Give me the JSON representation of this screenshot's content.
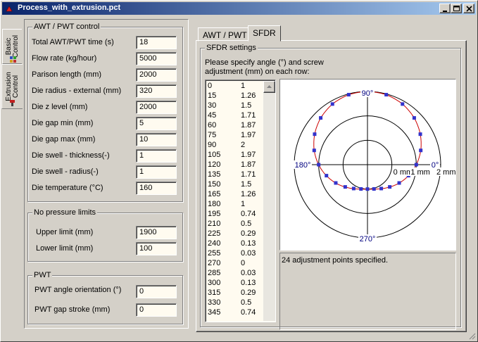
{
  "window": {
    "title": "Process_with_extrusion.pct"
  },
  "side_tabs": [
    {
      "label": "Basic Control",
      "line1": "Basic",
      "line2": "Control"
    },
    {
      "label": "Extrusion Control",
      "line1": "Extrusion",
      "line2": "Control"
    }
  ],
  "awt_pwt_control": {
    "title": "AWT / PWT control",
    "fields": [
      {
        "label": "Total AWT/PWT time (s)",
        "value": "18"
      },
      {
        "label": "Flow rate (kg/hour)",
        "value": "5000"
      },
      {
        "label": "Parison length (mm)",
        "value": "2000"
      },
      {
        "label": "Die radius - external (mm)",
        "value": "320"
      },
      {
        "label": "Die z level (mm)",
        "value": "2000"
      },
      {
        "label": "Die gap min (mm)",
        "value": "5"
      },
      {
        "label": "Die gap max (mm)",
        "value": "10"
      },
      {
        "label": "Die swell - thickness(-)",
        "value": "1"
      },
      {
        "label": "Die swell - radius(-)",
        "value": "1"
      },
      {
        "label": "Die temperature (°C)",
        "value": "160"
      }
    ]
  },
  "no_pressure_limits": {
    "title": "No pressure limits",
    "fields": [
      {
        "label": "Upper limit (mm)",
        "value": "1900"
      },
      {
        "label": "Lower limit (mm)",
        "value": "100"
      }
    ]
  },
  "pwt": {
    "title": "PWT",
    "fields": [
      {
        "label": "PWT angle orientation (°)",
        "value": "0"
      },
      {
        "label": "PWT gap stroke (mm)",
        "value": "0"
      }
    ]
  },
  "tabs": [
    {
      "label": "AWT / PWT",
      "active": false
    },
    {
      "label": "SFDR",
      "active": true
    }
  ],
  "sfdr": {
    "title": "SFDR settings",
    "instruction_line1": "Please specify angle (°) and screw",
    "instruction_line2": "adjustment (mm) on each row:",
    "rows": [
      {
        "angle": "0",
        "adj": "1"
      },
      {
        "angle": "15",
        "adj": "1.26"
      },
      {
        "angle": "30",
        "adj": "1.5"
      },
      {
        "angle": "45",
        "adj": "1.71"
      },
      {
        "angle": "60",
        "adj": "1.87"
      },
      {
        "angle": "75",
        "adj": "1.97"
      },
      {
        "angle": "90",
        "adj": "2"
      },
      {
        "angle": "105",
        "adj": "1.97"
      },
      {
        "angle": "120",
        "adj": "1.87"
      },
      {
        "angle": "135",
        "adj": "1.71"
      },
      {
        "angle": "150",
        "adj": "1.5"
      },
      {
        "angle": "165",
        "adj": "1.26"
      },
      {
        "angle": "180",
        "adj": "1"
      },
      {
        "angle": "195",
        "adj": "0.74"
      },
      {
        "angle": "210",
        "adj": "0.5"
      },
      {
        "angle": "225",
        "adj": "0.29"
      },
      {
        "angle": "240",
        "adj": "0.13"
      },
      {
        "angle": "255",
        "adj": "0.03"
      },
      {
        "angle": "270",
        "adj": "0"
      },
      {
        "angle": "285",
        "adj": "0.03"
      },
      {
        "angle": "300",
        "adj": "0.13"
      },
      {
        "angle": "315",
        "adj": "0.29"
      },
      {
        "angle": "330",
        "adj": "0.5"
      },
      {
        "angle": "345",
        "adj": "0.74"
      }
    ],
    "status": "24 adjustment points specified."
  },
  "chart_data": {
    "type": "polar",
    "angles_deg": [
      0,
      15,
      30,
      45,
      60,
      75,
      90,
      105,
      120,
      135,
      150,
      165,
      180,
      195,
      210,
      225,
      240,
      255,
      270,
      285,
      300,
      315,
      330,
      345
    ],
    "values_mm": [
      1,
      1.26,
      1.5,
      1.71,
      1.87,
      1.97,
      2,
      1.97,
      1.87,
      1.71,
      1.5,
      1.26,
      1,
      0.74,
      0.5,
      0.29,
      0.13,
      0.03,
      0,
      0.03,
      0.13,
      0.29,
      0.5,
      0.74
    ],
    "radial_range": [
      -1,
      2
    ],
    "ring_labels": [
      "0 mm",
      "1 mm",
      "2 mm"
    ],
    "angle_labels": [
      "0°",
      "90°",
      "180°",
      "270°"
    ],
    "colors": {
      "curve": "#cc0000",
      "points": "#3333cc",
      "grid": "#000000",
      "labels": "#000080"
    }
  },
  "colors": {
    "title_start": "#0a246a",
    "title_end": "#a6caf0",
    "field_bg": "#fffbf0"
  }
}
